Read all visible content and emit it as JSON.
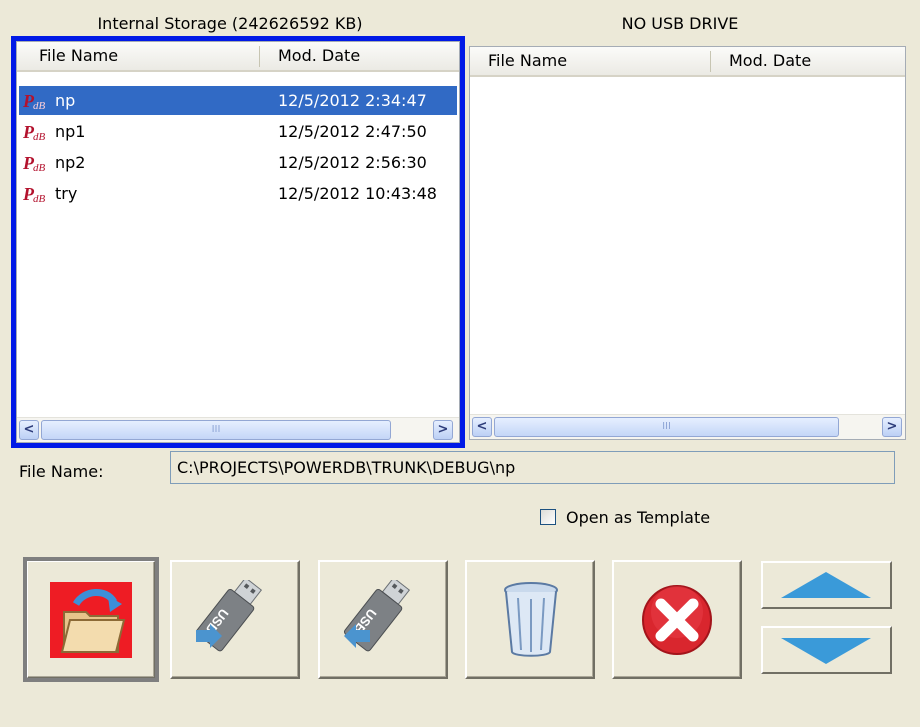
{
  "internal": {
    "title": "Internal Storage (242626592 KB)",
    "columns": [
      "File Name",
      "Mod. Date"
    ],
    "files": [
      {
        "name": "np",
        "date": "12/5/2012 2:34:47",
        "selected": true
      },
      {
        "name": "np1",
        "date": "12/5/2012 2:47:50",
        "selected": false
      },
      {
        "name": "np2",
        "date": "12/5/2012 2:56:30",
        "selected": false
      },
      {
        "name": "try",
        "date": "12/5/2012 10:43:48",
        "selected": false
      }
    ]
  },
  "usb": {
    "title": "NO USB DRIVE",
    "columns": [
      "File Name",
      "Mod. Date"
    ],
    "files": []
  },
  "file_name": {
    "label": "File Name:",
    "value": "C:\\PROJECTS\\POWERDB\\TRUNK\\DEBUG\\np"
  },
  "open_as_template": {
    "label": "Open as Template",
    "checked": false
  },
  "scrollbar": {
    "left_arrow": "<",
    "right_arrow": ">",
    "thumb_grip": "III"
  },
  "toolbar": {
    "usb_text": "USB",
    "buttons": [
      {
        "name": "open-button",
        "icon": "open-folder-icon"
      },
      {
        "name": "copy-to-usb-button",
        "icon": "usb-export-icon"
      },
      {
        "name": "copy-from-usb-button",
        "icon": "usb-import-icon"
      },
      {
        "name": "delete-button",
        "icon": "trash-icon"
      },
      {
        "name": "cancel-button",
        "icon": "close-icon"
      },
      {
        "name": "scroll-up-button",
        "icon": "triangle-up-icon"
      },
      {
        "name": "scroll-down-button",
        "icon": "triangle-down-icon"
      }
    ]
  },
  "colors": {
    "focus_frame": "#0019e6",
    "selection": "#316ac5",
    "arrow_blue": "#3a9ad9",
    "cancel_red": "#d9262e"
  }
}
